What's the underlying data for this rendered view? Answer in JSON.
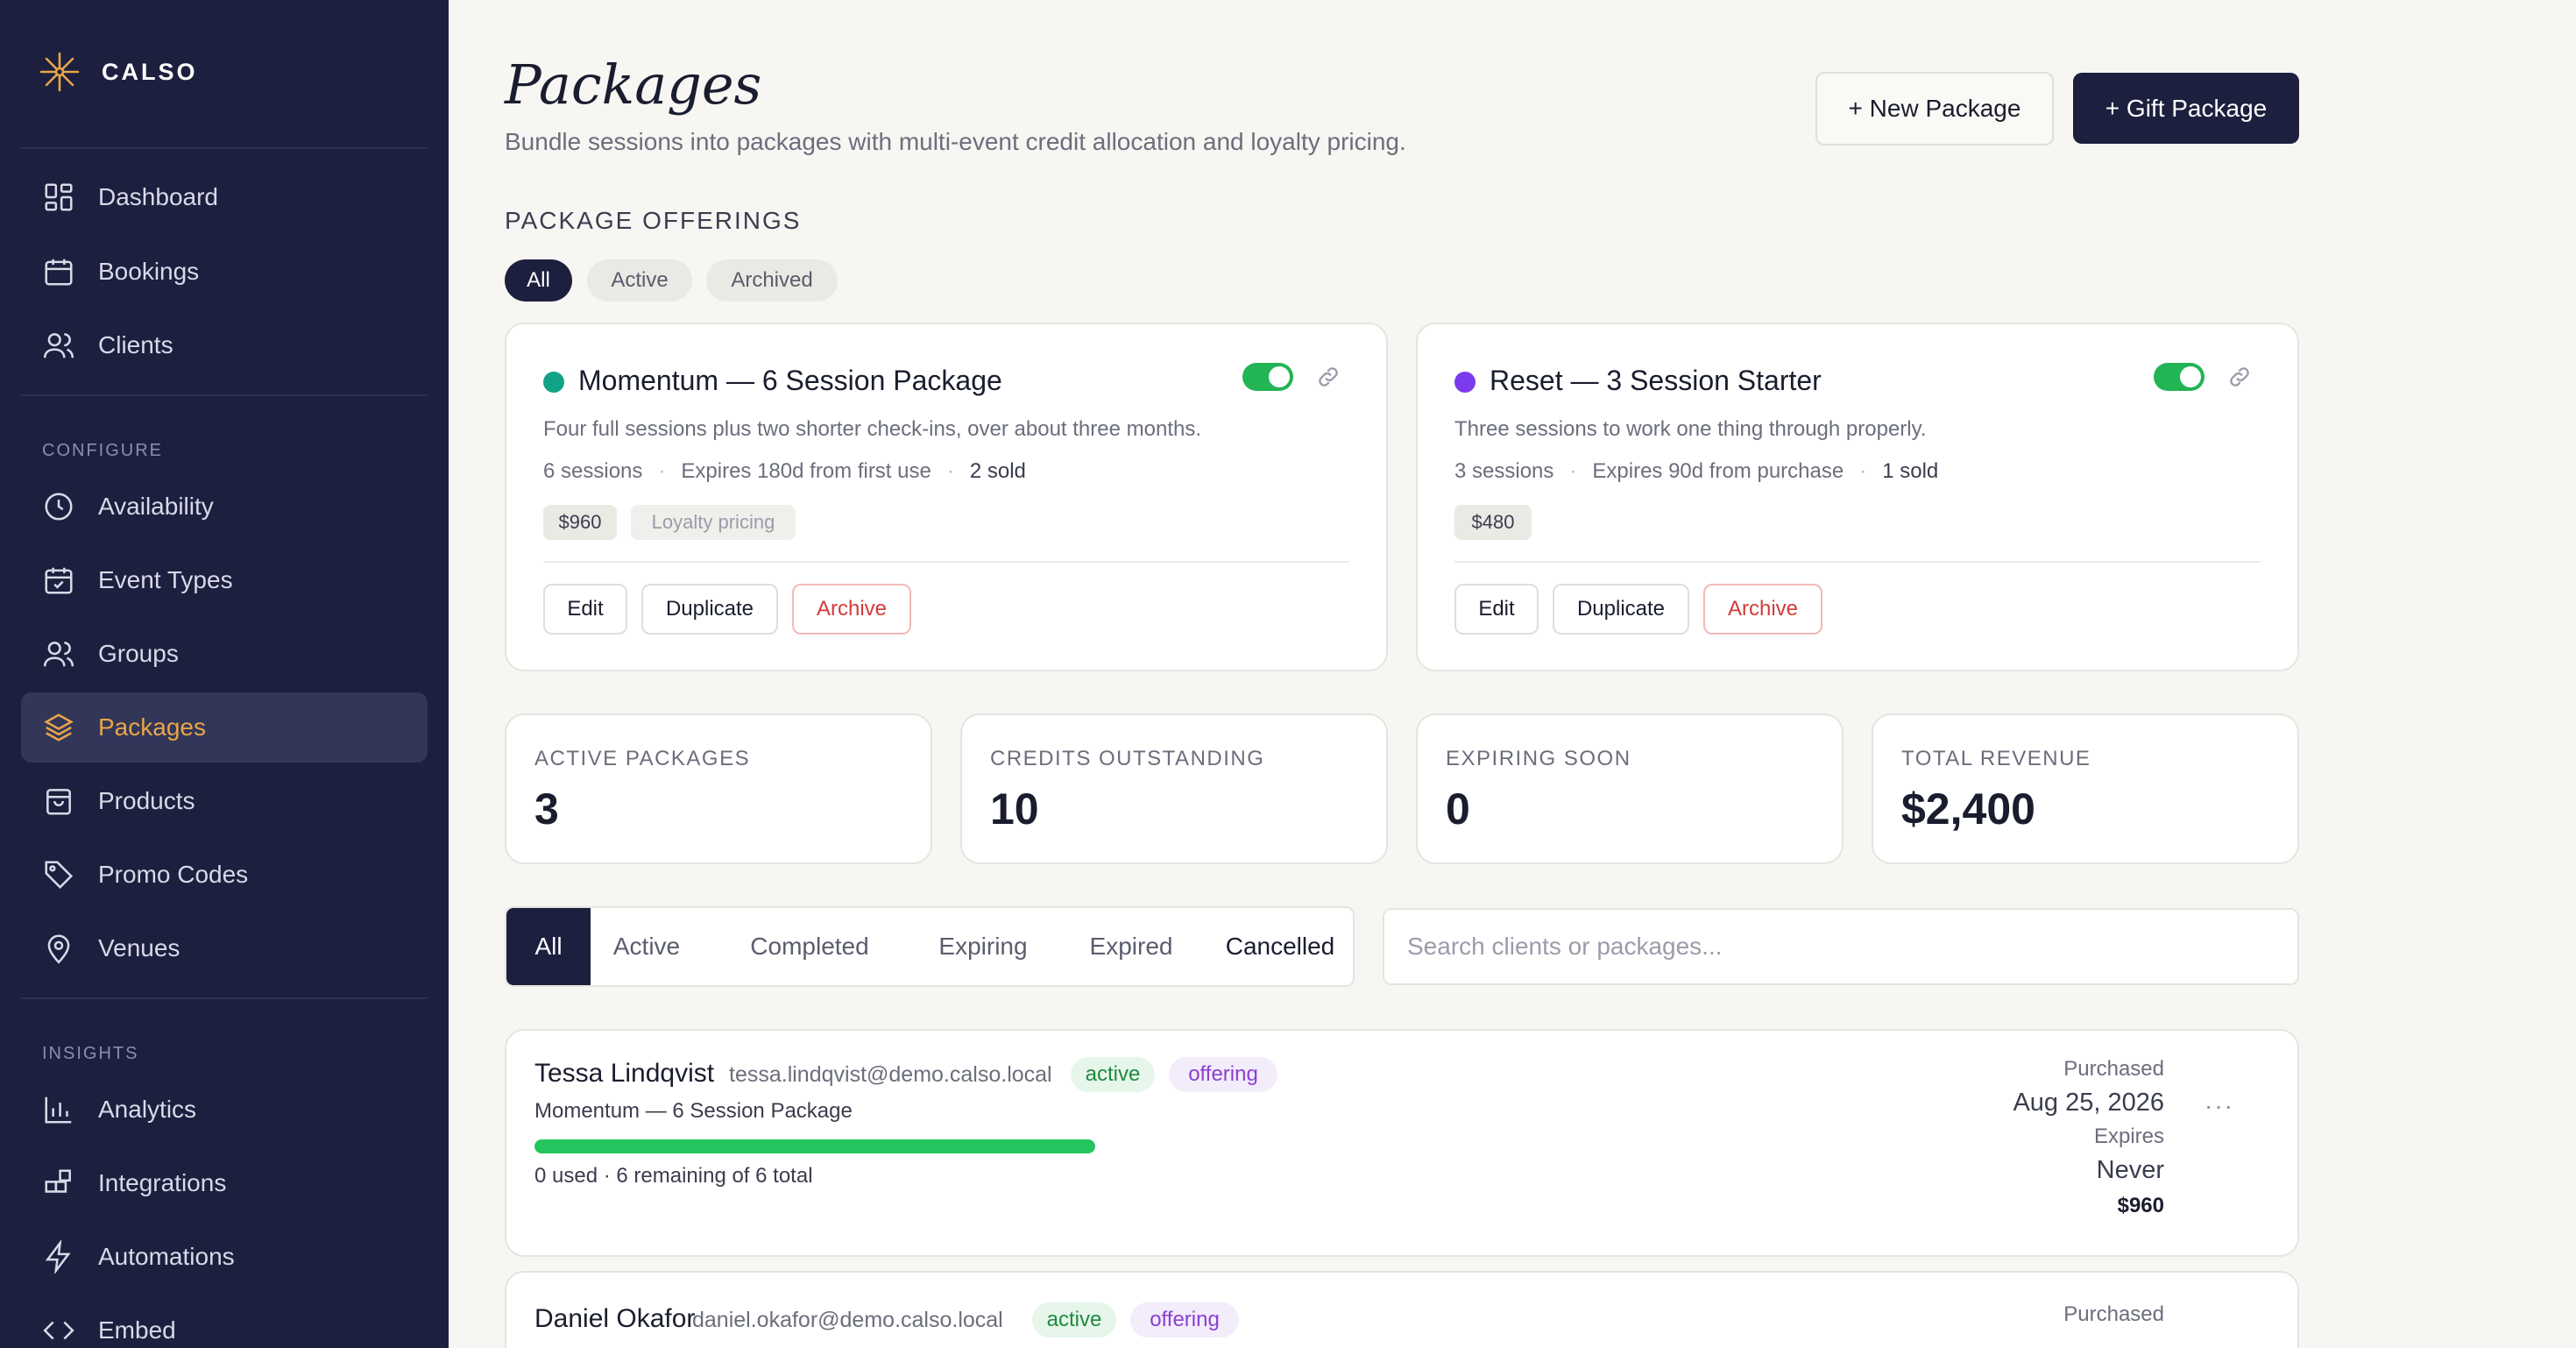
{
  "brand": {
    "name": "CALSO",
    "accent": "#e8a648"
  },
  "sidebar": {
    "primary": [
      {
        "label": "Dashboard",
        "icon": "dashboard-icon"
      },
      {
        "label": "Bookings",
        "icon": "calendar-icon"
      },
      {
        "label": "Clients",
        "icon": "users-icon"
      }
    ],
    "configure_heading": "CONFIGURE",
    "configure": [
      {
        "label": "Availability",
        "icon": "clock-icon"
      },
      {
        "label": "Event Types",
        "icon": "calendar-check-icon"
      },
      {
        "label": "Groups",
        "icon": "group-icon"
      },
      {
        "label": "Packages",
        "icon": "layers-icon",
        "active": true
      },
      {
        "label": "Products",
        "icon": "bag-icon"
      },
      {
        "label": "Promo Codes",
        "icon": "tag-icon"
      },
      {
        "label": "Venues",
        "icon": "map-pin-icon"
      }
    ],
    "insights_heading": "INSIGHTS",
    "insights": [
      {
        "label": "Analytics",
        "icon": "bar-chart-icon"
      },
      {
        "label": "Integrations",
        "icon": "puzzle-icon"
      },
      {
        "label": "Automations",
        "icon": "lightning-icon"
      },
      {
        "label": "Embed",
        "icon": "code-icon"
      }
    ]
  },
  "header": {
    "title": "Packages",
    "subtitle": "Bundle sessions into packages with multi-event credit allocation and loyalty pricing.",
    "new_button": "+ New Package",
    "gift_button": "+ Gift Package"
  },
  "offerings": {
    "label": "PACKAGE OFFERINGS",
    "filters": [
      "All",
      "Active",
      "Archived"
    ],
    "selected_filter": "All",
    "cards": [
      {
        "title": "Momentum — 6 Session Package",
        "dot_color": "#12a386",
        "description": "Four full sessions plus two shorter check-ins, over about three months.",
        "sessions": "6 sessions",
        "expiry": "Expires 180d from first use",
        "sold": "2 sold",
        "price": "$960",
        "extra_tag": "Loyalty pricing",
        "enabled": true,
        "actions": [
          "Edit",
          "Duplicate",
          "Archive"
        ]
      },
      {
        "title": "Reset — 3 Session Starter",
        "dot_color": "#7c3aed",
        "description": "Three sessions to work one thing through properly.",
        "sessions": "3 sessions",
        "expiry": "Expires 90d from purchase",
        "sold": "1 sold",
        "price": "$480",
        "extra_tag": "",
        "enabled": true,
        "actions": [
          "Edit",
          "Duplicate",
          "Archive"
        ]
      }
    ]
  },
  "stats": [
    {
      "label": "ACTIVE PACKAGES",
      "value": "3"
    },
    {
      "label": "CREDITS OUTSTANDING",
      "value": "10"
    },
    {
      "label": "EXPIRING SOON",
      "value": "0"
    },
    {
      "label": "TOTAL REVENUE",
      "value": "$2,400"
    }
  ],
  "purchases": {
    "tabs": [
      "All",
      "Active",
      "Completed",
      "Expiring",
      "Expired",
      "Cancelled"
    ],
    "selected_tab": "All",
    "search_placeholder": "Search clients or packages...",
    "rows": [
      {
        "name": "Tessa Lindqvist",
        "email": "tessa.lindqvist@demo.calso.local",
        "status": "active",
        "type": "offering",
        "package": "Momentum — 6 Session Package",
        "progress": 1.0,
        "usage": "0 used · 6 remaining of 6 total",
        "purchased_label": "Purchased",
        "purchased": "Aug 25, 2026",
        "expires_label": "Expires",
        "expires": "Never",
        "price": "$960",
        "menu": "···"
      },
      {
        "name": "Daniel Okafor",
        "email": "daniel.okafor@demo.calso.local",
        "status": "active",
        "type": "offering",
        "purchased_label": "Purchased"
      }
    ]
  }
}
